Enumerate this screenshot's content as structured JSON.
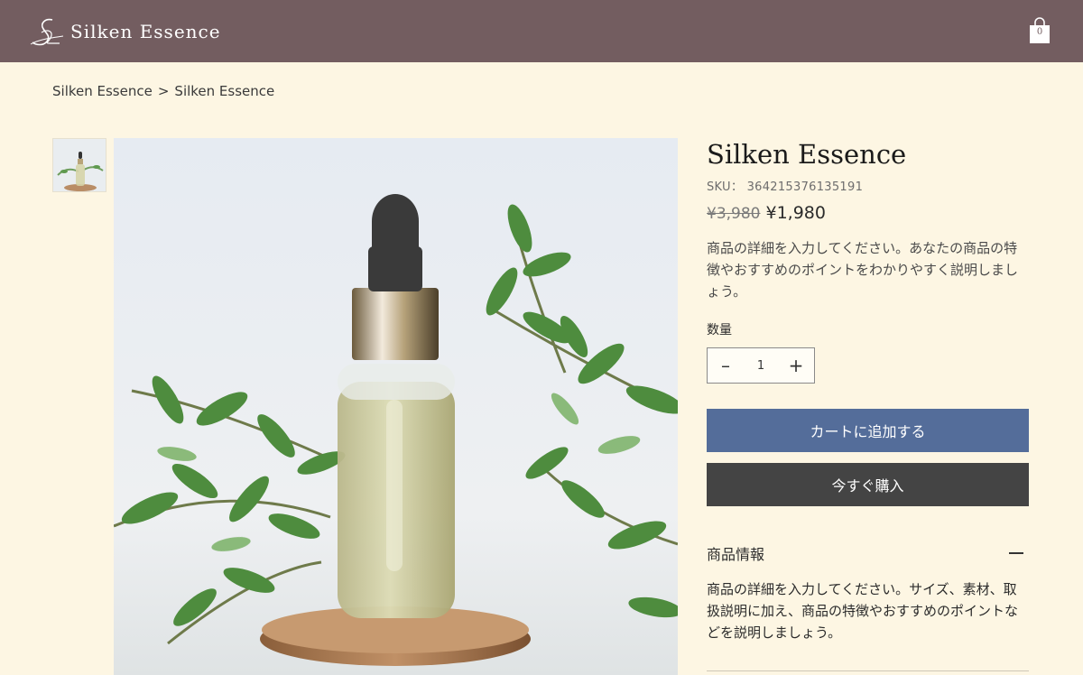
{
  "header": {
    "brand_name": "Silken Essence",
    "cart_count": "0",
    "background_color": "#735d60"
  },
  "breadcrumb": {
    "items": [
      "Silken Essence",
      "Silken Essence"
    ],
    "separator": ">"
  },
  "product": {
    "title": "Silken Essence",
    "sku": "SKU： 364215376135191",
    "original_price": "¥3,980",
    "sale_price": "¥1,980",
    "description": "商品の詳細を入力してください。あなたの商品の特徴やおすすめのポイントをわかりやすく説明しましょう。",
    "quantity_label": "数量",
    "quantity_value": "1",
    "add_to_cart_label": "カートに追加する",
    "buy_now_label": "今すぐ購入",
    "add_to_cart_color": "#546d9a",
    "buy_now_color": "#444444"
  },
  "info_section": {
    "title": "商品情報",
    "body": "商品の詳細を入力してください。サイズ、素材、取扱説明に加え、商品の特徴やおすすめのポイントなどを説明しましょう。"
  },
  "icons": {
    "logo": "script-s-logo-icon",
    "cart": "shopping-bag-icon",
    "minus": "minus-icon",
    "plus": "plus-icon",
    "collapse": "collapse-minus-icon"
  }
}
